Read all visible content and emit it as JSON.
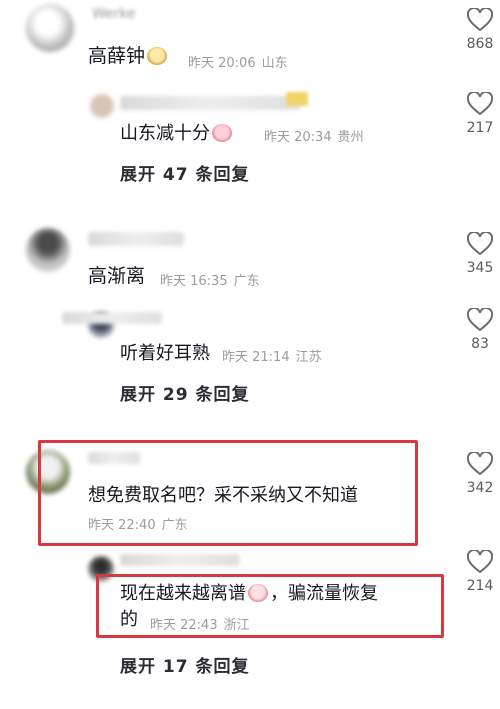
{
  "comments": [
    {
      "name_partial": "Werke",
      "text": "高薛钟",
      "emoji": "dog-face-emoji",
      "time": "昨天 20:06",
      "location": "山东",
      "likes": "868",
      "reply": {
        "text": "山东减十分",
        "emoji": "pig-emoji",
        "time": "昨天 20:34",
        "location": "贵州",
        "likes": "217"
      },
      "expand_label": "展开 47 条回复"
    },
    {
      "text": "高渐离",
      "time": "昨天 16:35",
      "location": "广东",
      "likes": "345",
      "reply": {
        "text": "听着好耳熟",
        "time": "昨天 21:14",
        "location": "江苏",
        "likes": "83"
      },
      "expand_label": "展开 29 条回复"
    },
    {
      "text": "想免费取名吧？采不采纳又不知道",
      "time": "昨天 22:40",
      "location": "广东",
      "likes": "342",
      "reply": {
        "text_line1": "现在越来越离谱",
        "emoji": "sad-face-emoji",
        "text_line1b": "，骗流量恢复",
        "text_line2": "的",
        "time": "昨天 22:43",
        "location": "浙江",
        "likes": "214"
      },
      "expand_label": "展开 17 条回复"
    }
  ],
  "colors": {
    "highlight_box": "#d8383f",
    "meta_text": "#9a9ba0",
    "primary_text": "#161823"
  }
}
